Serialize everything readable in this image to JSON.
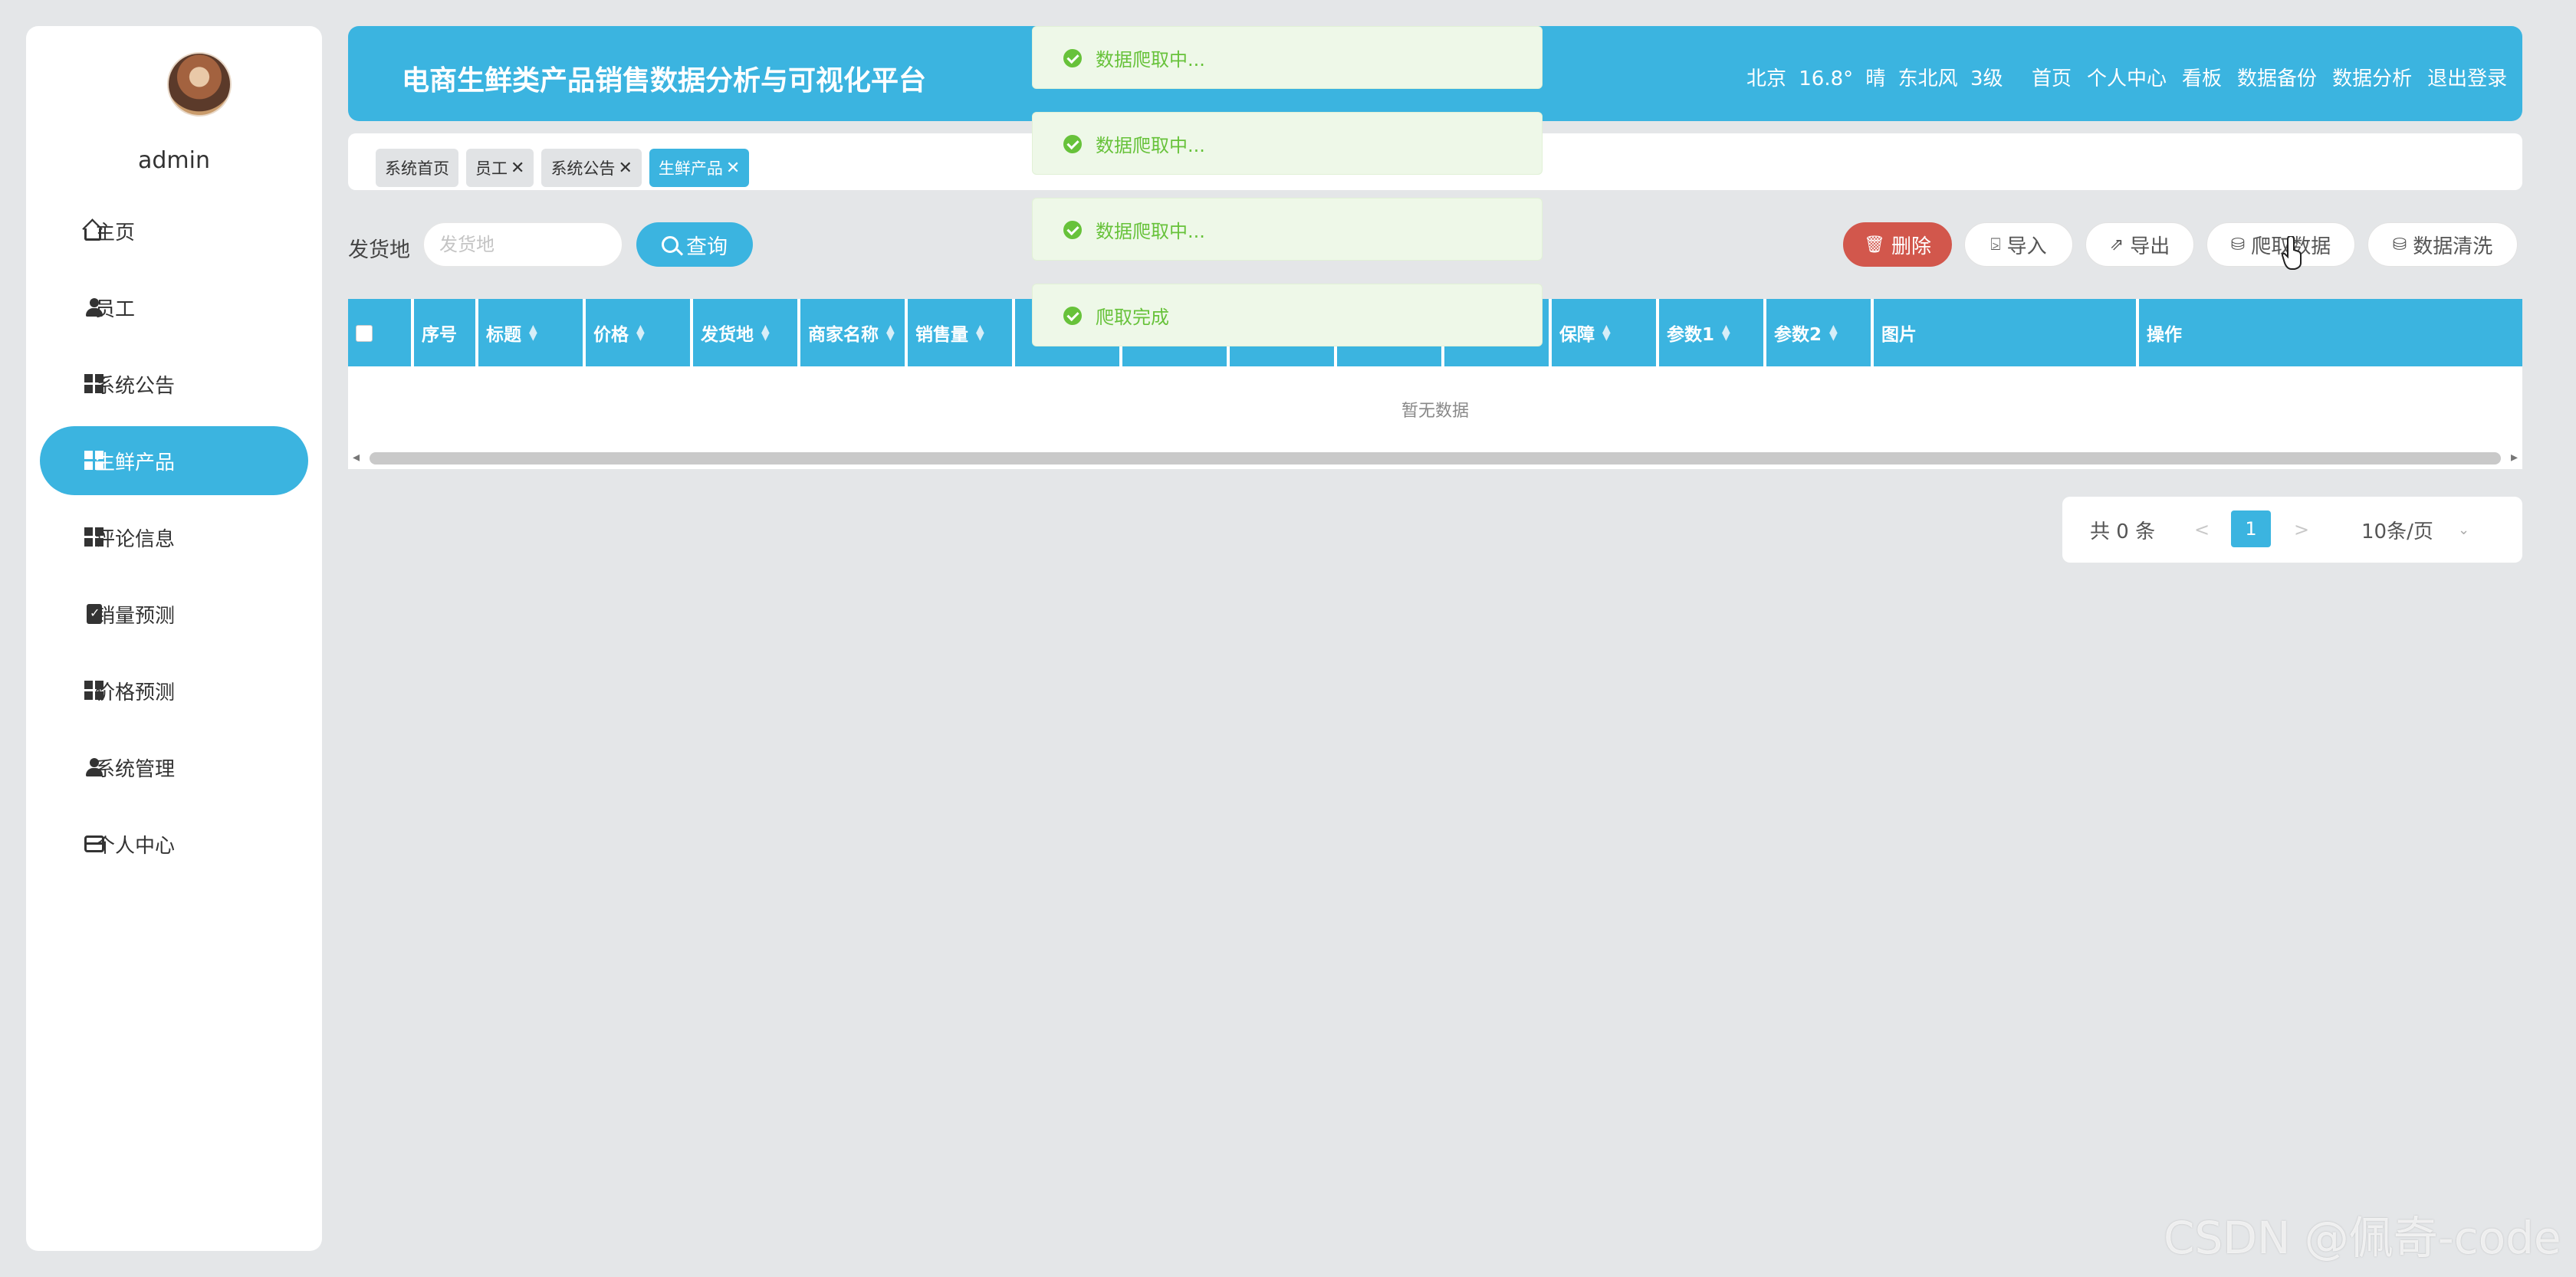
{
  "user": {
    "name": "admin"
  },
  "sidebar": {
    "items": [
      {
        "label": "主页",
        "icon": "home-icon"
      },
      {
        "label": "员工",
        "icon": "user-icon"
      },
      {
        "label": "系统公告",
        "icon": "grid-icon"
      },
      {
        "label": "生鲜产品",
        "icon": "grid-icon",
        "active": true
      },
      {
        "label": "评论信息",
        "icon": "grid-icon"
      },
      {
        "label": "销量预测",
        "icon": "clipboard-icon"
      },
      {
        "label": "价格预测",
        "icon": "grid-icon"
      },
      {
        "label": "系统管理",
        "icon": "user-icon"
      },
      {
        "label": "个人中心",
        "icon": "card-icon"
      }
    ]
  },
  "header": {
    "title": "电商生鲜类产品销售数据分析与可视化平台",
    "weather": "北京 16.8° 晴 东北风 3级",
    "nav": [
      "首页",
      "个人中心",
      "看板",
      "数据备份",
      "数据分析",
      "退出登录"
    ]
  },
  "tabs": [
    {
      "label": "系统首页",
      "closable": false
    },
    {
      "label": "员工",
      "closable": true
    },
    {
      "label": "系统公告",
      "closable": true
    },
    {
      "label": "生鲜产品",
      "closable": true,
      "active": true
    }
  ],
  "search": {
    "label": "发货地",
    "placeholder": "发货地",
    "button": "查询"
  },
  "actions": {
    "delete": "删除",
    "import": "导入",
    "export": "导出",
    "crawl": "爬取数据",
    "clean": "数据清洗"
  },
  "table": {
    "columns": [
      "序号",
      "标题",
      "价格",
      "发货地",
      "商家名称",
      "销售量",
      "",
      "",
      "",
      "",
      "",
      "保障",
      "参数1",
      "参数2",
      "图片",
      "操作"
    ],
    "empty_text": "暂无数据"
  },
  "pagination": {
    "total": "共 0 条",
    "prev": "<",
    "current": "1",
    "next": ">",
    "page_size": "10条/页"
  },
  "toasts": [
    "数据爬取中...",
    "数据爬取中...",
    "数据爬取中...",
    "爬取完成"
  ],
  "colors": {
    "primary": "#3bb4e0",
    "danger": "#d2574c",
    "success": "#67c23a"
  },
  "watermark": "CSDN @佩奇-code"
}
